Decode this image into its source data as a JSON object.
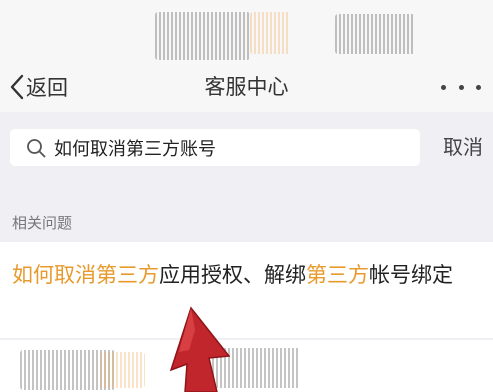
{
  "nav": {
    "back_label": "返回",
    "title": "客服中心"
  },
  "search": {
    "query": "如何取消第三方账号",
    "cancel_label": "取消"
  },
  "section": {
    "label": "相关问题"
  },
  "results": [
    {
      "segments": [
        {
          "text": "如何取消第三方",
          "highlight": true
        },
        {
          "text": "应用授权、解绑",
          "highlight": false
        },
        {
          "text": "第三方",
          "highlight": true
        },
        {
          "text": "帐号绑定",
          "highlight": false
        }
      ]
    }
  ],
  "colors": {
    "highlight": "#e89a2c",
    "pointer": "#c0262b",
    "background": "#efeff4"
  },
  "icons": {
    "back": "chevron-left-icon",
    "more": "more-dots-icon",
    "search": "search-icon",
    "pointer": "red-arrow-pointer"
  }
}
